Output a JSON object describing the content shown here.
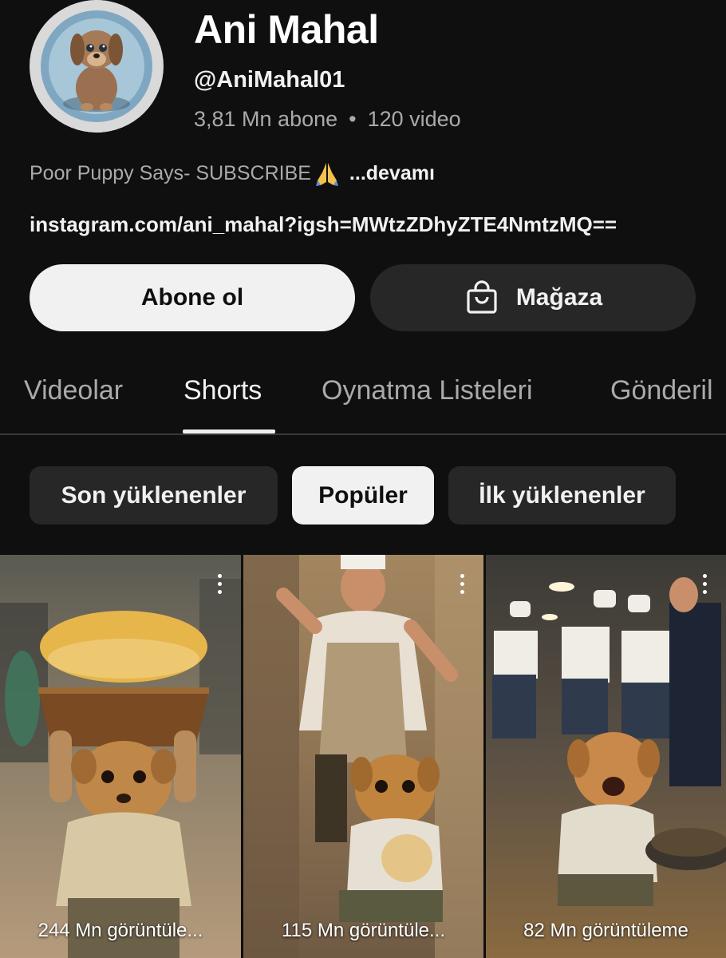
{
  "channel": {
    "name": "Ani Mahal",
    "handle": "@AniMahal01",
    "subscribers": "3,81 Mn abone",
    "separator": "•",
    "videos": "120 video",
    "description": "Poor Puppy Says- SUBSCRIBE",
    "description_emoji": "folded-hands-emoji",
    "more_label": "...devamı",
    "link": "instagram.com/ani_mahal?igsh=MWtzZDhyZTE4NmtzMQ=="
  },
  "actions": {
    "subscribe_label": "Abone ol",
    "store_label": "Mağaza",
    "store_icon": "shopping-bag-icon"
  },
  "tabs": [
    {
      "label": "Videolar",
      "active": false
    },
    {
      "label": "Shorts",
      "active": true
    },
    {
      "label": "Oynatma Listeleri",
      "active": false
    },
    {
      "label": "Gönderil",
      "active": false
    }
  ],
  "filters": [
    {
      "label": "Son yüklenenler",
      "selected": false
    },
    {
      "label": "Popüler",
      "selected": true
    },
    {
      "label": "İlk yüklenenler",
      "selected": false
    }
  ],
  "shorts": [
    {
      "views": "244 Mn görüntüle...",
      "menu_icon": "more-vert-icon"
    },
    {
      "views": "115 Mn görüntüle...",
      "menu_icon": "more-vert-icon"
    },
    {
      "views": "82 Mn görüntüleme",
      "menu_icon": "more-vert-icon"
    }
  ],
  "colors": {
    "background": "#0f0f0f",
    "primary_text": "#f1f1f1",
    "secondary_text": "#aaaaaa",
    "chip_bg": "#272727"
  }
}
